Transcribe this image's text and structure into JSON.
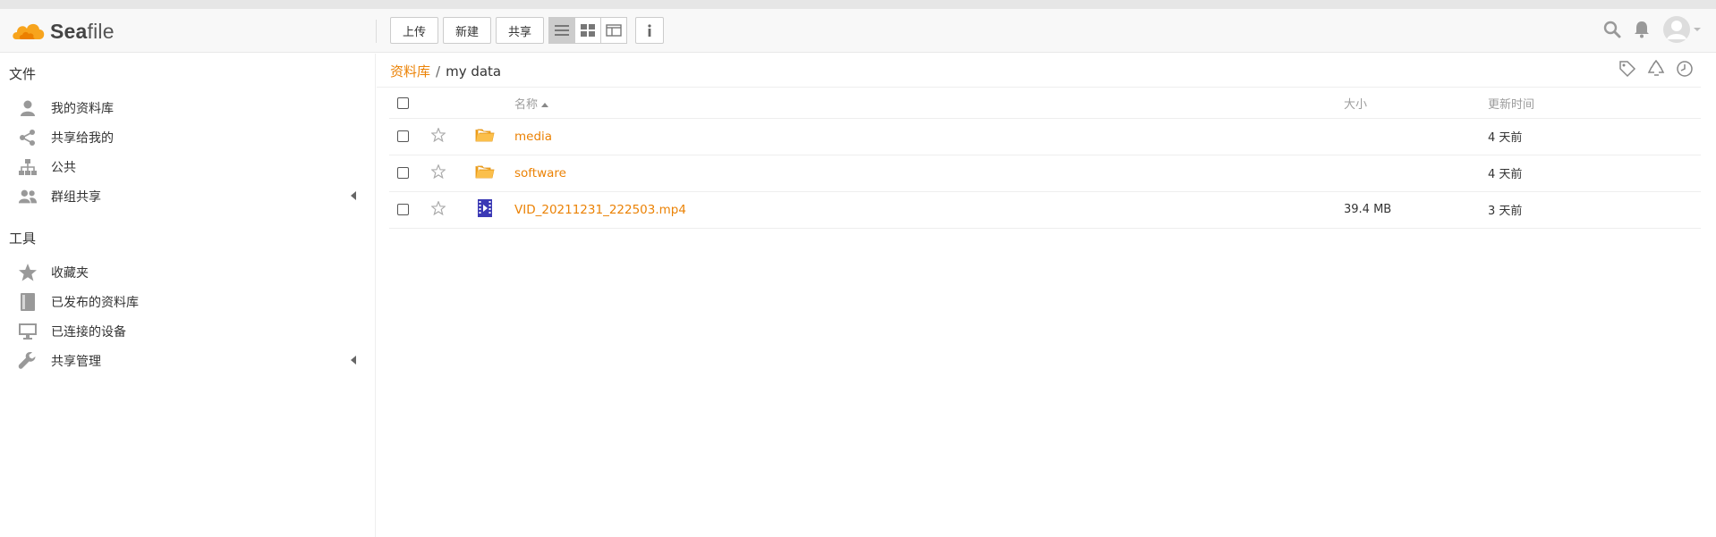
{
  "app": {
    "logo_text_bold": "Sea",
    "logo_text_rest": "file",
    "accent": "#eb8205"
  },
  "toolbar": {
    "upload_label": "上传",
    "new_label": "新建",
    "share_label": "共享",
    "view_modes": [
      "list-view-icon",
      "grid-view-icon",
      "column-view-icon"
    ],
    "active_view": "list"
  },
  "header_icons": [
    "search-icon",
    "bell-icon",
    "avatar"
  ],
  "sidebar": {
    "files_title": "文件",
    "files_items": [
      {
        "label": "我的资料库",
        "icon": "user-icon"
      },
      {
        "label": "共享给我的",
        "icon": "share-icon"
      },
      {
        "label": "公共",
        "icon": "org-icon"
      },
      {
        "label": "群组共享",
        "icon": "group-icon",
        "expandable": true
      }
    ],
    "tools_title": "工具",
    "tools_items": [
      {
        "label": "收藏夹",
        "icon": "star-icon"
      },
      {
        "label": "已发布的资料库",
        "icon": "book-icon"
      },
      {
        "label": "已连接的设备",
        "icon": "monitor-icon"
      },
      {
        "label": "共享管理",
        "icon": "wrench-icon",
        "expandable": true
      }
    ]
  },
  "breadcrumb": {
    "repo": "资料库",
    "separator": "/",
    "current": "my data"
  },
  "table": {
    "headers": {
      "name": "名称",
      "size": "大小",
      "modified": "更新时间"
    },
    "rows": [
      {
        "name": "media",
        "type": "folder",
        "size": "",
        "modified": "4 天前"
      },
      {
        "name": "software",
        "type": "folder",
        "size": "",
        "modified": "4 天前"
      },
      {
        "name": "VID_20211231_222503.mp4",
        "type": "video",
        "size": "39.4 MB",
        "modified": "3 天前"
      }
    ]
  }
}
